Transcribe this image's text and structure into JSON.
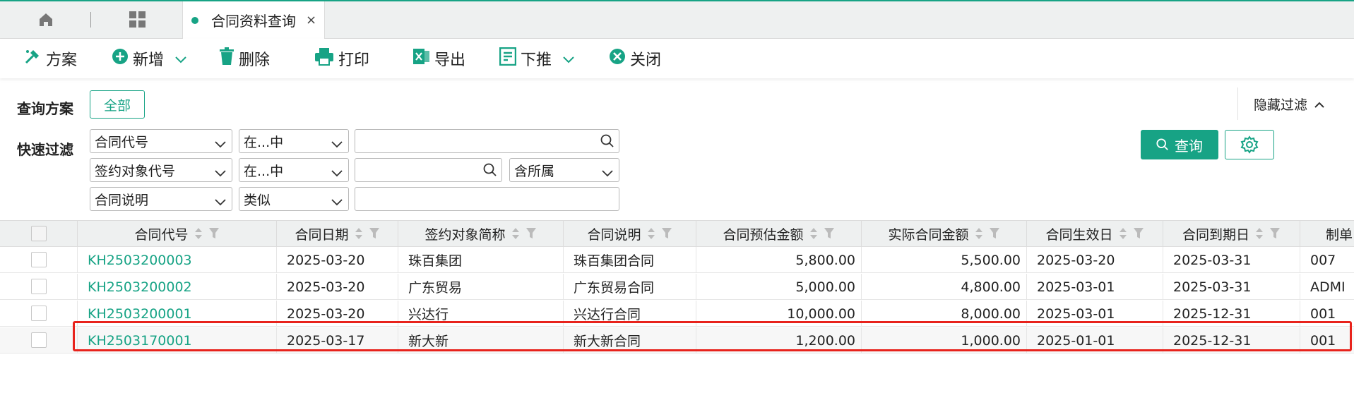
{
  "tabs": {
    "home_icon": "home-icon",
    "apps_icon": "grid-icon",
    "active_tab": {
      "label": "合同资料查询",
      "close": "×"
    }
  },
  "toolbar": {
    "items": [
      {
        "label": "方案",
        "icon": "scheme-icon"
      },
      {
        "label": "新增",
        "icon": "plus-circle-icon",
        "dropdown": true
      },
      {
        "label": "删除",
        "icon": "trash-icon"
      },
      {
        "label": "打印",
        "icon": "printer-icon"
      },
      {
        "label": "导出",
        "icon": "excel-icon"
      },
      {
        "label": "下推",
        "icon": "push-down-icon",
        "dropdown": true
      },
      {
        "label": "关闭",
        "icon": "close-circle-icon"
      }
    ]
  },
  "filter": {
    "scheme_label": "查询方案",
    "scheme_all": "全部",
    "hide_filter": "隐藏过滤",
    "quick_label": "快速过滤",
    "rows": [
      {
        "field": "合同代号",
        "operator": "在...中",
        "value": ""
      },
      {
        "field": "签约对象代号",
        "operator": "在...中",
        "value": "",
        "extra": "含所属"
      },
      {
        "field": "合同说明",
        "operator": "类似",
        "value": ""
      }
    ],
    "query_button": "查询"
  },
  "grid": {
    "columns": [
      "合同代号",
      "合同日期",
      "签约对象简称",
      "合同说明",
      "合同预估金额",
      "实际合同金额",
      "合同生效日",
      "合同到期日",
      "制单"
    ],
    "rows": [
      [
        "KH2503200003",
        "2025-03-20",
        "珠百集团",
        "珠百集团合同",
        "5,800.00",
        "5,500.00",
        "2025-03-20",
        "2025-03-31",
        "007"
      ],
      [
        "KH2503200002",
        "2025-03-20",
        "广东贸易",
        "广东贸易合同",
        "5,000.00",
        "4,800.00",
        "2025-03-01",
        "2025-03-31",
        "ADMI"
      ],
      [
        "KH2503200001",
        "2025-03-20",
        "兴达行",
        "兴达行合同",
        "10,000.00",
        "8,000.00",
        "2025-03-01",
        "2025-12-31",
        "001"
      ],
      [
        "KH2503170001",
        "2025-03-17",
        "新大新",
        "新大新合同",
        "1,200.00",
        "1,000.00",
        "2025-01-01",
        "2025-12-31",
        "001"
      ]
    ],
    "highlighted_row": 3
  },
  "colors": {
    "accent": "#17a385",
    "highlight": "#e8231c"
  }
}
